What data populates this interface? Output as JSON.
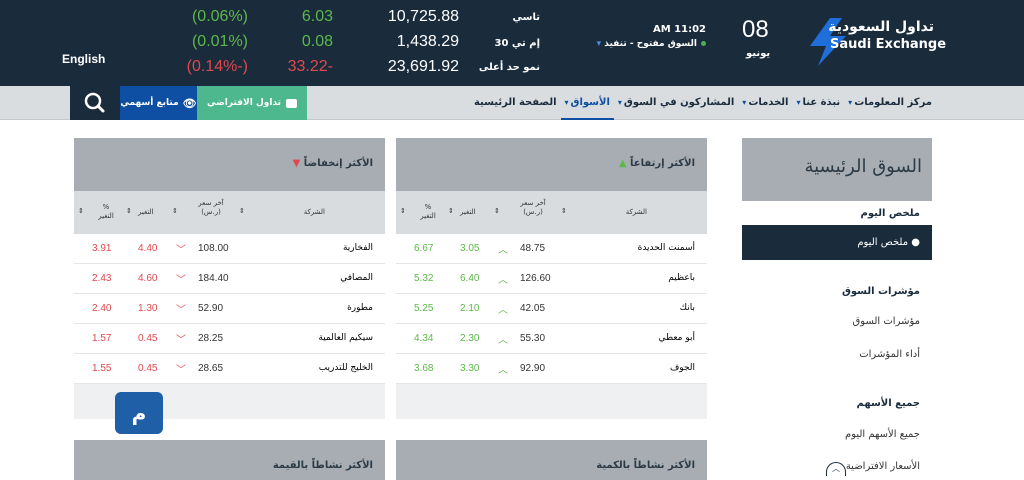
{
  "header": {
    "logo_ar": "تداول السعودية",
    "logo_en": "Saudi Exchange",
    "day_number": "08",
    "day_name": "يونيو",
    "time": "AM 11:02",
    "market_status": "السوق مفتوح - تنفيذ",
    "language": "English",
    "indices": [
      {
        "name": "تاسي",
        "value": "10,725.88",
        "change": "6.03",
        "percent": "(0.06%)",
        "direction": "up"
      },
      {
        "name": "إم تي 30",
        "value": "1,438.29",
        "change": "0.08",
        "percent": "(0.01%)",
        "direction": "up"
      },
      {
        "name": "نمو حد أعلى",
        "value": "23,691.92",
        "change": "33.22-",
        "percent": "(0.14%-)",
        "direction": "down"
      }
    ]
  },
  "nav": {
    "virtual_trading": "تداول الافتراضي",
    "watchlist": "متابع أسهمي",
    "items": [
      {
        "label": "الصفحة الرئيسية",
        "dropdown": false,
        "active": false
      },
      {
        "label": "الأسواق",
        "dropdown": true,
        "active": true
      },
      {
        "label": "المشاركون في السوق",
        "dropdown": true,
        "active": false
      },
      {
        "label": "الخدمات",
        "dropdown": true,
        "active": false
      },
      {
        "label": "نبذة عنا",
        "dropdown": true,
        "active": false
      },
      {
        "label": "مركز المعلومات",
        "dropdown": true,
        "active": false
      }
    ]
  },
  "sidebar": {
    "title": "السوق الرئيسية",
    "items": [
      {
        "label": "ملخص اليوم",
        "kind": "hdr"
      },
      {
        "label": "ملخص اليوم",
        "kind": "active"
      },
      {
        "label": "مؤشرات السوق",
        "kind": "hdr"
      },
      {
        "label": "مؤشرات السوق",
        "kind": "sub"
      },
      {
        "label": "أداء المؤشرات",
        "kind": "sub"
      },
      {
        "label": "جميع الأسهم",
        "kind": "hdr"
      },
      {
        "label": "جميع الأسهم اليوم",
        "kind": "sub"
      },
      {
        "label": "الأسعار الافتراضية",
        "kind": "sub"
      }
    ]
  },
  "columns": {
    "company": "الشركة",
    "last_price": "آخر سعر (ر.س)",
    "change": "التغير",
    "percent": "% التغير"
  },
  "gainers": {
    "title": "الأكثر إرتفاعاً",
    "rows": [
      {
        "company": "أسمنت الحديدة",
        "price": "48.75",
        "change": "3.05",
        "percent": "6.67"
      },
      {
        "company": "باعظيم",
        "price": "126.60",
        "change": "6.40",
        "percent": "5.32"
      },
      {
        "company": "بانك",
        "price": "42.05",
        "change": "2.10",
        "percent": "5.25"
      },
      {
        "company": "أبو معطي",
        "price": "55.30",
        "change": "2.30",
        "percent": "4.34"
      },
      {
        "company": "الجوف",
        "price": "92.90",
        "change": "3.30",
        "percent": "3.68"
      }
    ]
  },
  "losers": {
    "title": "الأكثر إنخفاضاً",
    "rows": [
      {
        "company": "الفخارية",
        "price": "108.00",
        "change": "4.40",
        "percent": "3.91"
      },
      {
        "company": "المصافي",
        "price": "184.40",
        "change": "4.60",
        "percent": "2.43"
      },
      {
        "company": "مطورة",
        "price": "52.90",
        "change": "1.30",
        "percent": "2.40"
      },
      {
        "company": "سيكيم العالمية",
        "price": "28.25",
        "change": "0.45",
        "percent": "1.57"
      },
      {
        "company": "الخليج للتدريب",
        "price": "28.65",
        "change": "0.45",
        "percent": "1.55"
      }
    ]
  },
  "lower_panels": {
    "by_quantity": "الأكثر نشاطاً بالكمية",
    "by_value": "الأكثر نشاطاً بالقيمة"
  },
  "colors": {
    "up": "#5db84a",
    "down": "#e0484f",
    "navy": "#1a2b3c",
    "blue": "#0e4fa3",
    "green_btn": "#4db88e"
  }
}
